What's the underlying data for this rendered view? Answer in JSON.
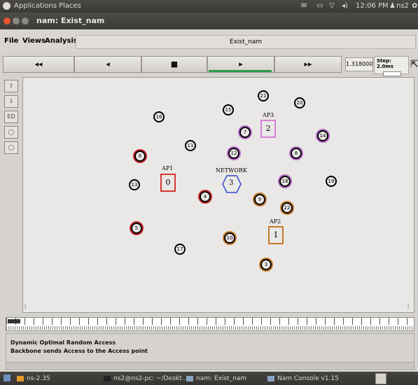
{
  "top_panel": {
    "applications": "Applications",
    "places": "Places",
    "clock": "12:06 PM",
    "user": "ns2"
  },
  "window": {
    "title": "nam: Exist_nam"
  },
  "menu": {
    "file": "File",
    "views": "Views",
    "analysis": "Analysis",
    "name_field": "Exist_nam"
  },
  "controls": {
    "rewind": "◂◂",
    "back": "◂",
    "stop": "■",
    "play": "▸",
    "fast_forward": "▸▸",
    "time": "1.318000",
    "step": "Step: 2.0ms"
  },
  "left_tools": [
    "⇧",
    "⇩",
    "ED",
    "◯",
    "◯"
  ],
  "canvas": {
    "nodes": [
      {
        "id": "21"
      },
      {
        "id": "20"
      },
      {
        "id": "15"
      },
      {
        "id": "16"
      },
      {
        "id": "7"
      },
      {
        "id": "14"
      },
      {
        "id": "6"
      },
      {
        "id": "11"
      },
      {
        "id": "12"
      },
      {
        "id": "8"
      },
      {
        "id": "13"
      },
      {
        "id": "4"
      },
      {
        "id": "9"
      },
      {
        "id": "18"
      },
      {
        "id": "19"
      },
      {
        "id": "5"
      },
      {
        "id": "10"
      },
      {
        "id": "17"
      },
      {
        "id": "22"
      },
      {
        "id": "3"
      }
    ],
    "access_points": [
      {
        "label": "AP1",
        "value": "0"
      },
      {
        "label": "AP2",
        "value": "1"
      },
      {
        "label": "AP3",
        "value": "2"
      }
    ],
    "network_label": "NETWORK",
    "network_value": "3"
  },
  "annotations": {
    "line1": "Dynamic Optimal Random Access",
    "line2": "Backbone sends Access to the Access point"
  },
  "taskbar": {
    "items": [
      "ns-2.35",
      "ns2@ns2-pc: ~/Deskt...",
      "nam: Exist_nam",
      "Nam Console v1.15"
    ]
  },
  "colors": {
    "ap1": "#d23a2f",
    "ap2": "#c7772a",
    "ap3": "#d57fd6",
    "network": "#3548c8",
    "play_indicator": "#2b9a4a"
  }
}
